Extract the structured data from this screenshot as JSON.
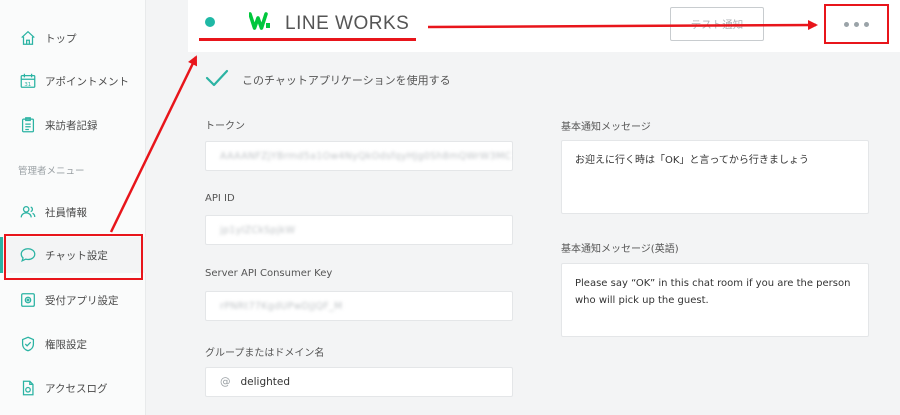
{
  "sidebar": {
    "items": [
      {
        "label": "トップ",
        "icon": "home-icon"
      },
      {
        "label": "アポイントメント",
        "icon": "calendar-icon"
      },
      {
        "label": "来訪者記録",
        "icon": "clipboard-icon"
      },
      {
        "label": "社員情報",
        "icon": "users-icon"
      },
      {
        "label": "チャット設定",
        "icon": "chat-icon"
      },
      {
        "label": "受付アプリ設定",
        "icon": "tablet-icon"
      },
      {
        "label": "権限設定",
        "icon": "shield-icon"
      },
      {
        "label": "アクセスログ",
        "icon": "log-icon"
      }
    ],
    "section_title": "管理者メニュー",
    "active_item": "チャット設定"
  },
  "header": {
    "app_name": "LINE WORKS",
    "test_button": "テスト通知",
    "status_color": "#1fb8a5"
  },
  "use_checkbox": {
    "label": "このチャットアプリケーションを使用する",
    "checked": true
  },
  "fields": {
    "token": {
      "label": "トークン",
      "value": "AAAANFZjYBrmd5a1Ow4NyQkOdsfqyHJg0Sh8mQWrW3MC"
    },
    "api_id": {
      "label": "API ID",
      "value": "jp1yIZCkSpjkW"
    },
    "consumer_key": {
      "label": "Server API Consumer Key",
      "value": "rPNRt77KgdUPwDjJQF_M"
    },
    "domain": {
      "label": "グループまたはドメイン名",
      "prefix": "@",
      "value": "delighted"
    },
    "basic_message": {
      "label": "基本通知メッセージ",
      "value": "お迎えに行く時は「OK」と言ってから行きましょう"
    },
    "basic_message_en": {
      "label": "基本通知メッセージ(英語)",
      "value": "Please say “OK” in this chat room if you are the person who will pick up the guest."
    }
  },
  "colors": {
    "accent": "#2bb3a3",
    "annotation": "#e8151b",
    "brand": "#00c73c"
  }
}
